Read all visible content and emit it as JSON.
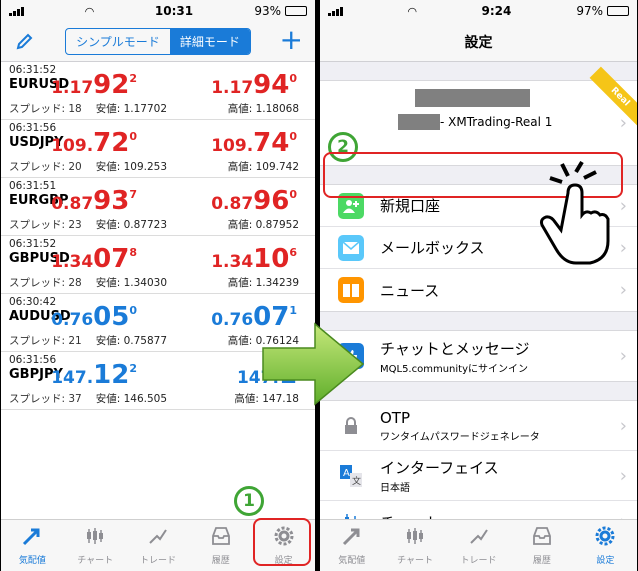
{
  "left": {
    "status": {
      "time": "10:31",
      "battery": "93%",
      "battery_level": 0.93
    },
    "segments": [
      "シンプルモード",
      "詳細モード"
    ],
    "active_segment": 1,
    "quotes": [
      {
        "time": "06:31:52",
        "symbol": "EURUSD",
        "spread": "スプレッド: 18",
        "color": "red",
        "bid": {
          "pre": "1.17",
          "big": "92",
          "sup": "2"
        },
        "ask": {
          "pre": "1.17",
          "big": "94",
          "sup": "0"
        },
        "low": "安値: 1.17702",
        "high": "高値: 1.18068"
      },
      {
        "time": "06:31:56",
        "symbol": "USDJPY",
        "spread": "スプレッド: 20",
        "color": "red",
        "bid": {
          "pre": "109.",
          "big": "72",
          "sup": "0"
        },
        "ask": {
          "pre": "109.",
          "big": "74",
          "sup": "0"
        },
        "low": "安値: 109.253",
        "high": "高値: 109.742"
      },
      {
        "time": "06:31:51",
        "symbol": "EURGBP",
        "spread": "スプレッド: 23",
        "color": "red",
        "bid": {
          "pre": "0.87",
          "big": "93",
          "sup": "7"
        },
        "ask": {
          "pre": "0.87",
          "big": "96",
          "sup": "0"
        },
        "low": "安値: 0.87723",
        "high": "高値: 0.87952"
      },
      {
        "time": "06:31:52",
        "symbol": "GBPUSD",
        "spread": "スプレッド: 28",
        "color": "red",
        "bid": {
          "pre": "1.34",
          "big": "07",
          "sup": "8"
        },
        "ask": {
          "pre": "1.34",
          "big": "10",
          "sup": "6"
        },
        "low": "安値: 1.34030",
        "high": "高値: 1.34239"
      },
      {
        "time": "06:30:42",
        "symbol": "AUDUSD",
        "spread": "スプレッド: 21",
        "color": "blue",
        "bid": {
          "pre": "0.76",
          "big": "05",
          "sup": "0"
        },
        "ask": {
          "pre": "0.76",
          "big": "07",
          "sup": "1"
        },
        "low": "安値: 0.75877",
        "high": "高値: 0.76124"
      },
      {
        "time": "06:31:56",
        "symbol": "GBPJPY",
        "spread": "スプレッド: 37",
        "color": "blue",
        "bid": {
          "pre": "147.",
          "big": "12",
          "sup": "2"
        },
        "ask": {
          "pre": "147.",
          "big": "1",
          "sup": ""
        },
        "low": "安値: 146.505",
        "high": "高値: 147.18"
      }
    ],
    "tabs": [
      "気配値",
      "チャート",
      "トレード",
      "履歴",
      "設定"
    ],
    "badge": "1"
  },
  "right": {
    "status": {
      "time": "9:24",
      "battery": "97%",
      "battery_level": 0.97
    },
    "title": "設定",
    "account_name": "- XMTrading-Real 1",
    "ribbon": "Real",
    "items_group1": [
      {
        "label": "新規口座",
        "icon": "add-user-icon",
        "color": "#4cd964"
      },
      {
        "label": "メールボックス",
        "icon": "mail-icon",
        "color": "#5ac8fa"
      },
      {
        "label": "ニュース",
        "icon": "book-icon",
        "color": "#ff9500"
      }
    ],
    "chat": {
      "label": "チャットとメッセージ",
      "sub": "MQL5.communityにサインイン",
      "icon": "thumbs-up-icon",
      "color": "#1a7bd8"
    },
    "items_group3": [
      {
        "label": "OTP",
        "sub": "ワンタイムパスワードジェネレータ",
        "icon": "lock-icon",
        "color": "#8e8e93"
      },
      {
        "label": "インターフェイス",
        "sub": "日本語",
        "icon": "translate-icon",
        "color": "#1a7bd8"
      },
      {
        "label": "チャート",
        "sub": "",
        "icon": "candle-icon",
        "color": "#1a7bd8"
      }
    ],
    "tabs": [
      "気配値",
      "チャート",
      "トレード",
      "履歴",
      "設定"
    ],
    "badge": "2"
  }
}
